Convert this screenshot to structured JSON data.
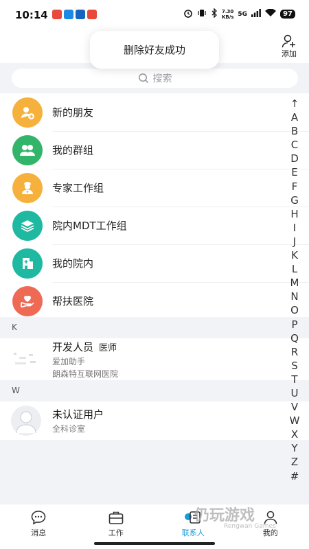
{
  "status_bar": {
    "time": "10:14",
    "net_speed_value": "7.30",
    "net_speed_unit": "KB/s",
    "net_type": "5G",
    "battery": "97"
  },
  "header": {
    "toast": "删除好友成功",
    "add_label": "添加"
  },
  "search": {
    "placeholder": "搜索"
  },
  "functions": [
    {
      "label": "新的朋友",
      "color": "#f5b13b",
      "icon": "person-add-icon"
    },
    {
      "label": "我的群组",
      "color": "#32b56a",
      "icon": "group-icon"
    },
    {
      "label": "专家工作组",
      "color": "#f5b13b",
      "icon": "doctor-icon"
    },
    {
      "label": "院内MDT工作组",
      "color": "#1fb8a0",
      "icon": "layers-icon"
    },
    {
      "label": "我的院内",
      "color": "#1fb8a0",
      "icon": "hospital-icon"
    },
    {
      "label": "帮扶医院",
      "color": "#ee6a55",
      "icon": "heart-hand-icon"
    }
  ],
  "sections": [
    {
      "letter": "K",
      "contacts": [
        {
          "name": "开发人员",
          "title": "医师",
          "sub1": "爱加助手",
          "sub2": "朗森特互联网医院"
        }
      ]
    },
    {
      "letter": "W",
      "contacts": [
        {
          "name": "未认证用户",
          "title": "",
          "sub1": "全科诊室",
          "sub2": ""
        }
      ]
    }
  ],
  "alpha_index": [
    "↑",
    "A",
    "B",
    "C",
    "D",
    "E",
    "F",
    "G",
    "H",
    "I",
    "J",
    "K",
    "L",
    "M",
    "N",
    "O",
    "P",
    "Q",
    "R",
    "S",
    "T",
    "U",
    "V",
    "W",
    "X",
    "Y",
    "Z",
    "#"
  ],
  "bottom_nav": [
    {
      "label": "消息",
      "icon": "chat-bubble-icon",
      "active": false
    },
    {
      "label": "工作",
      "icon": "briefcase-icon",
      "active": false
    },
    {
      "label": "联系人",
      "icon": "contacts-icon",
      "active": true
    },
    {
      "label": "我的",
      "icon": "profile-icon",
      "active": false
    }
  ],
  "watermark": {
    "main": "仍玩游戏",
    "sub": "Rengwan Games"
  },
  "colors": {
    "accent": "#1a9bd7",
    "background": "#f2f3f7"
  }
}
